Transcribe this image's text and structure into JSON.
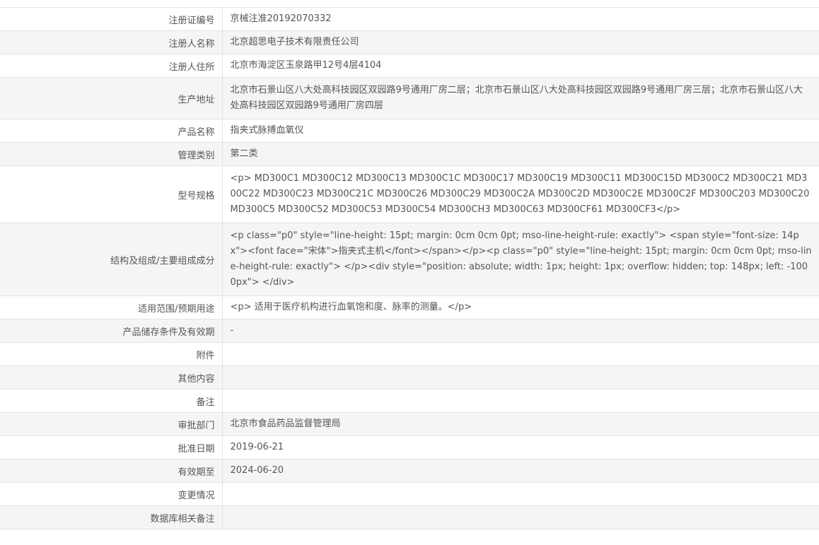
{
  "rows": [
    {
      "label": "注册证编号",
      "value": "京械注准20192070332"
    },
    {
      "label": "注册人名称",
      "value": "北京超思电子技术有限责任公司"
    },
    {
      "label": "注册人住所",
      "value": "北京市海淀区玉泉路甲12号4层4104"
    },
    {
      "label": "生产地址",
      "value": "北京市石景山区八大处高科技园区双园路9号通用厂房二层；北京市石景山区八大处高科技园区双园路9号通用厂房三层；北京市石景山区八大处高科技园区双园路9号通用厂房四层"
    },
    {
      "label": "产品名称",
      "value": "指夹式脉搏血氧仪"
    },
    {
      "label": "管理类别",
      "value": "第二类"
    },
    {
      "label": "型号规格",
      "value": "<p> MD300C1 MD300C12 MD300C13 MD300C1C MD300C17 MD300C19 MD300C11 MD300C15D MD300C2 MD300C21 MD300C22 MD300C23 MD300C21C MD300C26 MD300C29 MD300C2A MD300C2D MD300C2E MD300C2F MD300C203 MD300C20 MD300C5 MD300C52 MD300C53 MD300C54 MD300CH3 MD300C63 MD300CF61 MD300CF3</p>"
    },
    {
      "label": "结构及组成/主要组成成分",
      "value": "<p class=\"p0\" style=\"line-height: 15pt; margin: 0cm 0cm 0pt; mso-line-height-rule: exactly\"> <span style=\"font-size: 14px\"><font face=\"宋体\">指夹式主机</font></span></p><p class=\"p0\" style=\"line-height: 15pt; margin: 0cm 0cm 0pt; mso-line-height-rule: exactly\"> </p><div style=\"position: absolute; width: 1px; height: 1px; overflow: hidden; top: 148px; left: -1000px\"> </div>"
    },
    {
      "label": "适用范围/预期用途",
      "value": "<p> 适用于医疗机构进行血氧饱和度、脉率的测量。</p>"
    },
    {
      "label": "产品储存条件及有效期",
      "value": "-"
    },
    {
      "label": "附件",
      "value": ""
    },
    {
      "label": "其他内容",
      "value": ""
    },
    {
      "label": "备注",
      "value": ""
    },
    {
      "label": "审批部门",
      "value": "北京市食品药品监督管理局"
    },
    {
      "label": "批准日期",
      "value": "2019-06-21"
    },
    {
      "label": "有效期至",
      "value": "2024-06-20"
    },
    {
      "label": "变更情况",
      "value": ""
    },
    {
      "label": "数据库相关备注",
      "value": ""
    }
  ]
}
